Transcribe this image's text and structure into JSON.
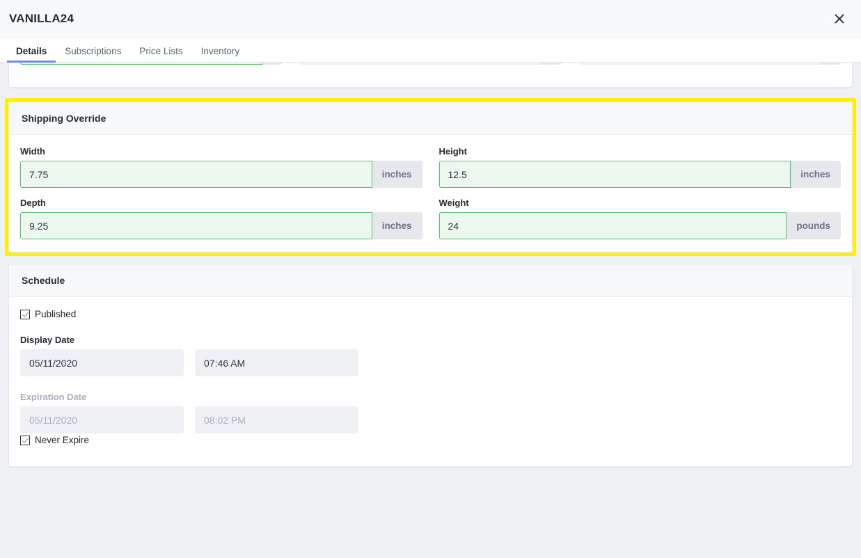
{
  "modal": {
    "title": "VANILLA24",
    "close_icon": "close-icon"
  },
  "tabs": [
    {
      "label": "Details",
      "active": true
    },
    {
      "label": "Subscriptions",
      "active": false
    },
    {
      "label": "Price Lists",
      "active": false
    },
    {
      "label": "Inventory",
      "active": false
    }
  ],
  "clipped_card": {
    "fields": [
      {
        "value": "",
        "suffix": ""
      },
      {
        "value": "",
        "suffix": ""
      },
      {
        "value": "",
        "suffix": ""
      }
    ]
  },
  "shipping_override": {
    "heading": "Shipping Override",
    "highlighted": true,
    "highlight_color": "#fff000",
    "fields": [
      {
        "label": "Width",
        "value": "7.75",
        "suffix": "inches"
      },
      {
        "label": "Height",
        "value": "12.5",
        "suffix": "inches"
      },
      {
        "label": "Depth",
        "value": "9.25",
        "suffix": "inches"
      },
      {
        "label": "Weight",
        "value": "24",
        "suffix": "pounds"
      }
    ]
  },
  "schedule": {
    "heading": "Schedule",
    "published": {
      "label": "Published",
      "checked": true
    },
    "display_date": {
      "label": "Display Date",
      "date": "05/11/2020",
      "time": "07:46 AM",
      "disabled": false
    },
    "expiration_date": {
      "label": "Expiration Date",
      "date": "05/11/2020",
      "time": "08:02 PM",
      "disabled": true
    },
    "never_expire": {
      "label": "Never Expire",
      "checked": true
    }
  }
}
